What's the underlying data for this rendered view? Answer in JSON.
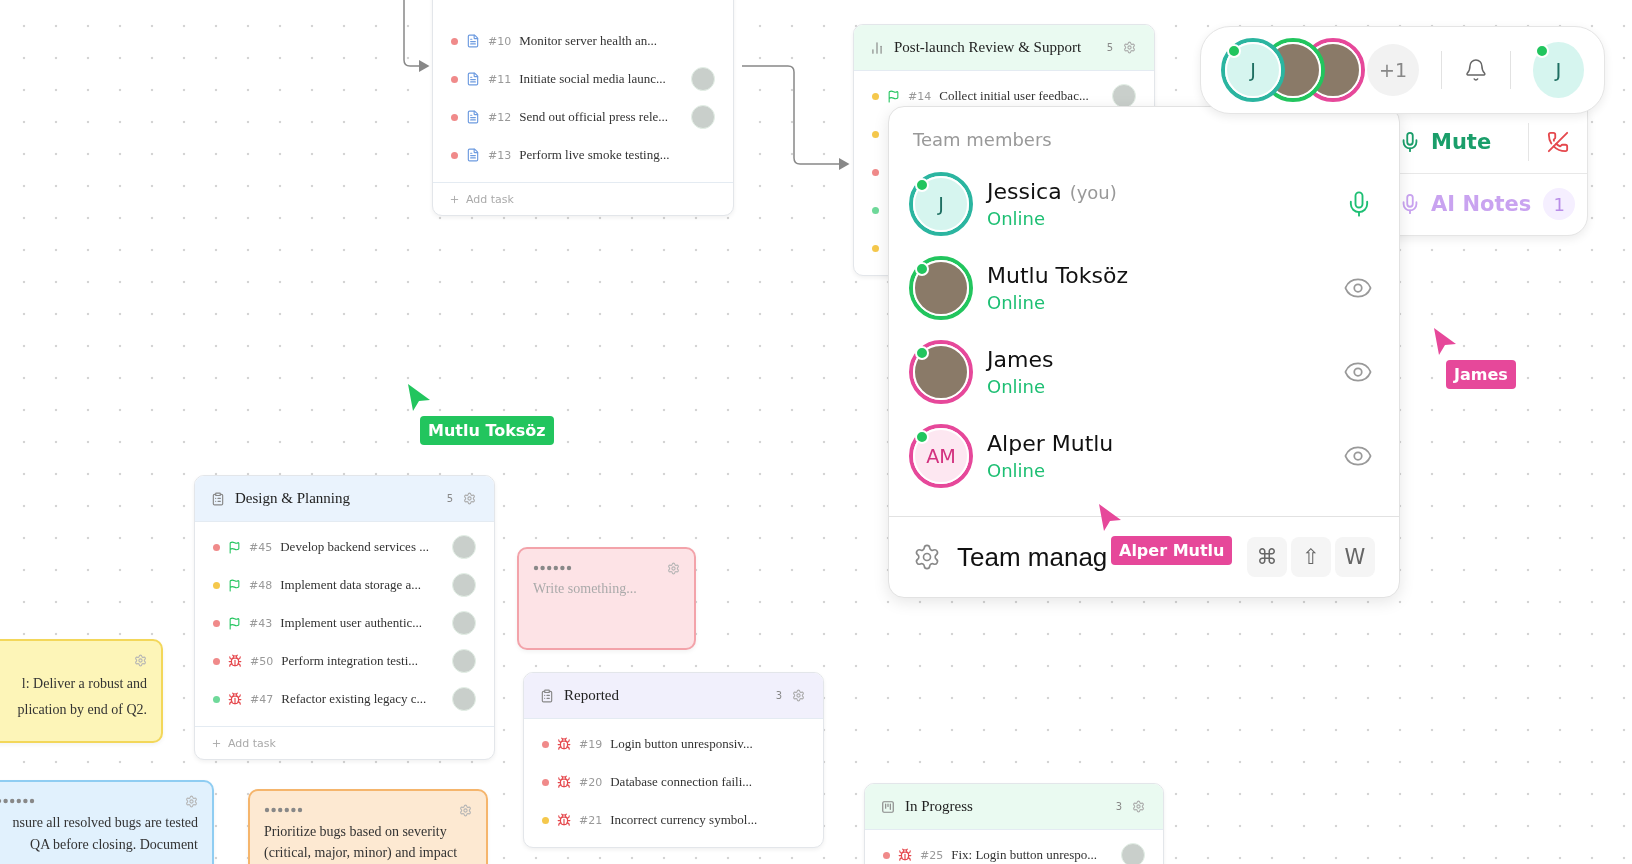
{
  "columns": [
    {
      "tasks": [
        {
          "number": "#10",
          "title": "Monitor server health an...",
          "color": "#f08a8a",
          "kind": "task",
          "assigned": false
        },
        {
          "number": "#11",
          "title": "Initiate social media launc...",
          "color": "#f08a8a",
          "kind": "task",
          "assigned": true
        },
        {
          "number": "#12",
          "title": "Send out official press rele...",
          "color": "#f08a8a",
          "kind": "task",
          "assigned": true
        },
        {
          "number": "#13",
          "title": "Perform live smoke testing...",
          "color": "#f08a8a",
          "kind": "task",
          "assigned": false
        }
      ],
      "add_label": "Add task"
    },
    {
      "title": "Post-launch Review & Support",
      "count": "5",
      "color": "#eafaf1",
      "tasks": [
        {
          "number": "#14",
          "title": "Collect initial user feedbac...",
          "color": "#f5c84c",
          "kind": "milestone",
          "assigned": true
        },
        {
          "color": "#f5c84c"
        },
        {
          "color": "#f08a8a"
        },
        {
          "color": "#6fd99a"
        },
        {
          "color": "#f5c84c"
        }
      ]
    },
    {
      "title": "Design & Planning",
      "count": "5",
      "color": "#eaf3fd",
      "tasks": [
        {
          "number": "#45",
          "title": "Develop backend services ...",
          "color": "#f08a8a",
          "kind": "milestone",
          "assigned": true
        },
        {
          "number": "#48",
          "title": "Implement data storage a...",
          "color": "#f5c84c",
          "kind": "milestone",
          "assigned": true
        },
        {
          "number": "#43",
          "title": "Implement user authentic...",
          "color": "#f08a8a",
          "kind": "milestone",
          "assigned": true
        },
        {
          "number": "#50",
          "title": "Perform integration testi...",
          "color": "#f08a8a",
          "kind": "bug",
          "assigned": true
        },
        {
          "number": "#47",
          "title": "Refactor existing legacy c...",
          "color": "#6fd99a",
          "kind": "bug",
          "assigned": true
        }
      ],
      "add_label": "Add task"
    },
    {
      "title": "Reported",
      "count": "3",
      "color": "#f1f0fc",
      "tasks": [
        {
          "number": "#19",
          "title": "Login button unresponsiv...",
          "color": "#f08a8a",
          "kind": "bug",
          "assigned": false
        },
        {
          "number": "#20",
          "title": "Database connection faili...",
          "color": "#f08a8a",
          "kind": "bug",
          "assigned": false
        },
        {
          "number": "#21",
          "title": "Incorrect currency symbol...",
          "color": "#f5c84c",
          "kind": "bug",
          "assigned": false
        }
      ]
    },
    {
      "title": "In Progress",
      "count": "3",
      "color": "#eafaf1",
      "tasks": [
        {
          "number": "#25",
          "title": "Fix: Login button unrespo...",
          "color": "#f08a8a",
          "kind": "bug",
          "assigned": true
        }
      ]
    }
  ],
  "notes": [
    {
      "color": "#fdf5b8",
      "handle": false,
      "lines": [
        "l: Deliver a robust and",
        "plication by end of Q2."
      ]
    },
    {
      "color": "#fde3e6",
      "handle": true,
      "placeholder": "Write something..."
    },
    {
      "color": "#e1f1fd",
      "handle": true,
      "lines": [
        "nsure all resolved bugs are tested",
        "QA before closing. Document"
      ]
    },
    {
      "color": "#fde9d2",
      "handle": true,
      "lines": [
        "Prioritize bugs based on severity",
        "(critical, major, minor) and impact"
      ]
    }
  ],
  "top_bar": {
    "participants": [
      {
        "kind": "initials",
        "initials": "J",
        "color": "#2bb5a0",
        "online": true
      },
      {
        "kind": "photo",
        "color": "#22c55e",
        "online": false
      },
      {
        "kind": "photo",
        "color": "#e6489a",
        "online": false
      }
    ],
    "overflow": "+1",
    "user": {
      "initials": "J",
      "online": true
    }
  },
  "call_panel": {
    "mute_label": "Mute",
    "notes_label": "AI Notes",
    "notes_count": "1"
  },
  "team_popup": {
    "title": "Team members",
    "members": [
      {
        "name": "Jessica",
        "suffix": "(you)",
        "status": "Online",
        "kind": "speaker",
        "avatar": {
          "kind": "initials",
          "initials": "J",
          "color": "#2bb5a0",
          "online": true
        }
      },
      {
        "name": "Mutlu Toksöz",
        "status": "Online",
        "kind": "viewer",
        "avatar": {
          "kind": "photo",
          "color": "#22c55e",
          "online": true
        }
      },
      {
        "name": "James",
        "status": "Online",
        "kind": "viewer",
        "avatar": {
          "kind": "photo",
          "color": "#e6489a",
          "online": true
        }
      },
      {
        "name": "Alper Mutlu",
        "status": "Online",
        "kind": "viewer",
        "avatar": {
          "kind": "initials",
          "initials": "AM",
          "color": "#e6489a",
          "online": true
        }
      }
    ],
    "footer_label": "Team manag",
    "keys": [
      "⌘",
      "⇧",
      "W"
    ]
  },
  "cursors": [
    {
      "label": "James",
      "color": "#e6489a"
    },
    {
      "label": "Mutlu Toksöz",
      "color": "#22c55e"
    },
    {
      "label": "Alper Mutlu",
      "color": "#e6489a"
    }
  ]
}
